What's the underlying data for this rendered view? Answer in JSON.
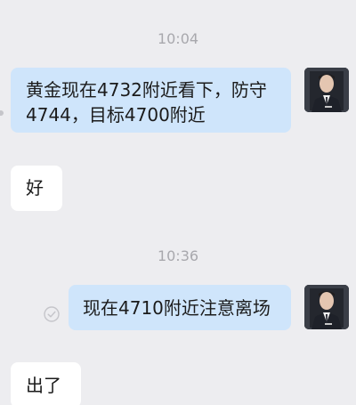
{
  "chat": {
    "messages": [
      {
        "type": "timestamp",
        "text": "10:04"
      },
      {
        "type": "outgoing",
        "text_line1": "黄金现在4732附近看下，防守",
        "text_line2": "4744，目标4700附近"
      },
      {
        "type": "incoming",
        "text": "好"
      },
      {
        "type": "timestamp",
        "text": "10:36"
      },
      {
        "type": "outgoing",
        "text": "现在4710附近注意离场",
        "status_icon": "check-circle-icon"
      },
      {
        "type": "incoming",
        "text": "出了"
      }
    ]
  },
  "colors": {
    "background": "#ededf0",
    "outgoing_bubble": "#cfe5fb",
    "incoming_bubble": "#ffffff",
    "timestamp_text": "#a8a8ad"
  }
}
